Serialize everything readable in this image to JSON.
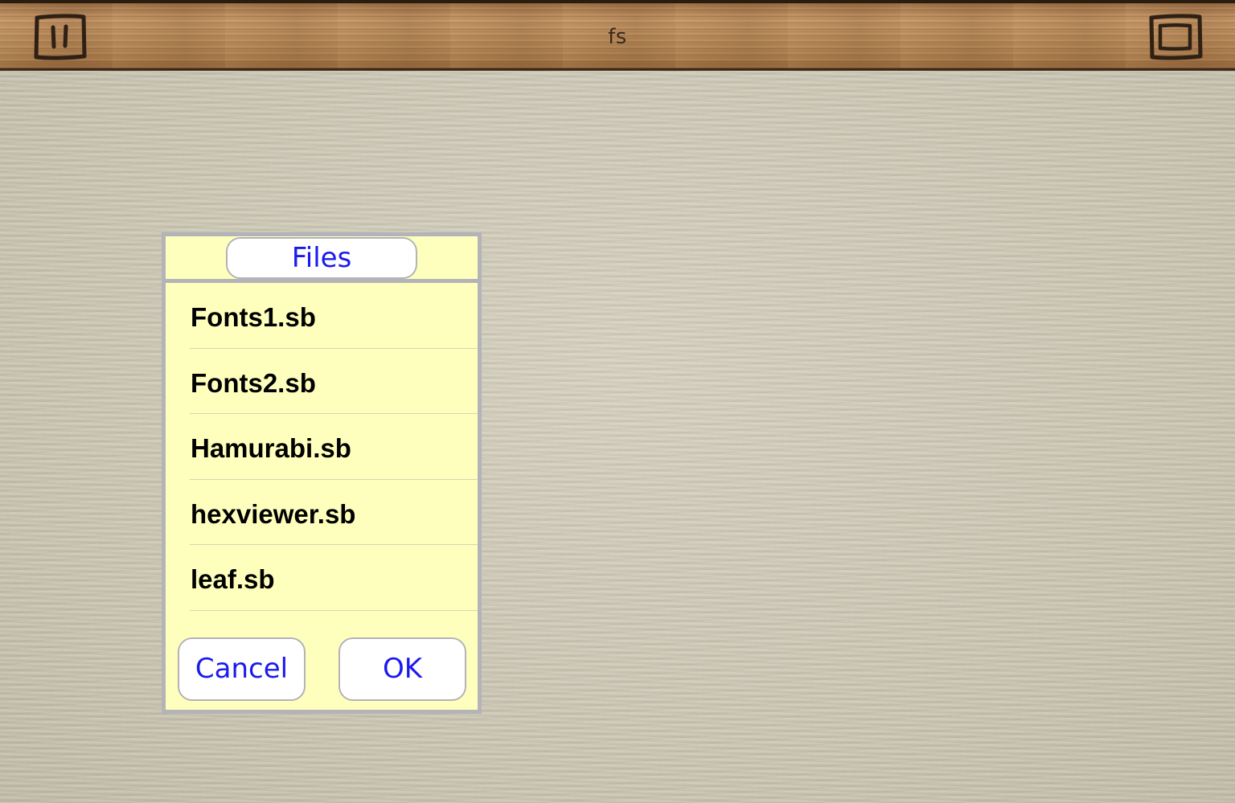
{
  "topbar": {
    "title": "fs",
    "left_icon": "pause-icon",
    "right_icon": "window-icon"
  },
  "dialog": {
    "title": "Files",
    "files": [
      {
        "name": "Fonts1.sb"
      },
      {
        "name": "Fonts2.sb"
      },
      {
        "name": "Hamurabi.sb"
      },
      {
        "name": "hexviewer.sb"
      },
      {
        "name": "leaf.sb"
      }
    ],
    "cancel_label": "Cancel",
    "ok_label": "OK"
  },
  "colors": {
    "dialog_bg": "#ffffbd",
    "border": "#b3b3b8",
    "button_text": "#1a1aee",
    "wood": "#b6895a",
    "paper": "#cdc8b6"
  }
}
